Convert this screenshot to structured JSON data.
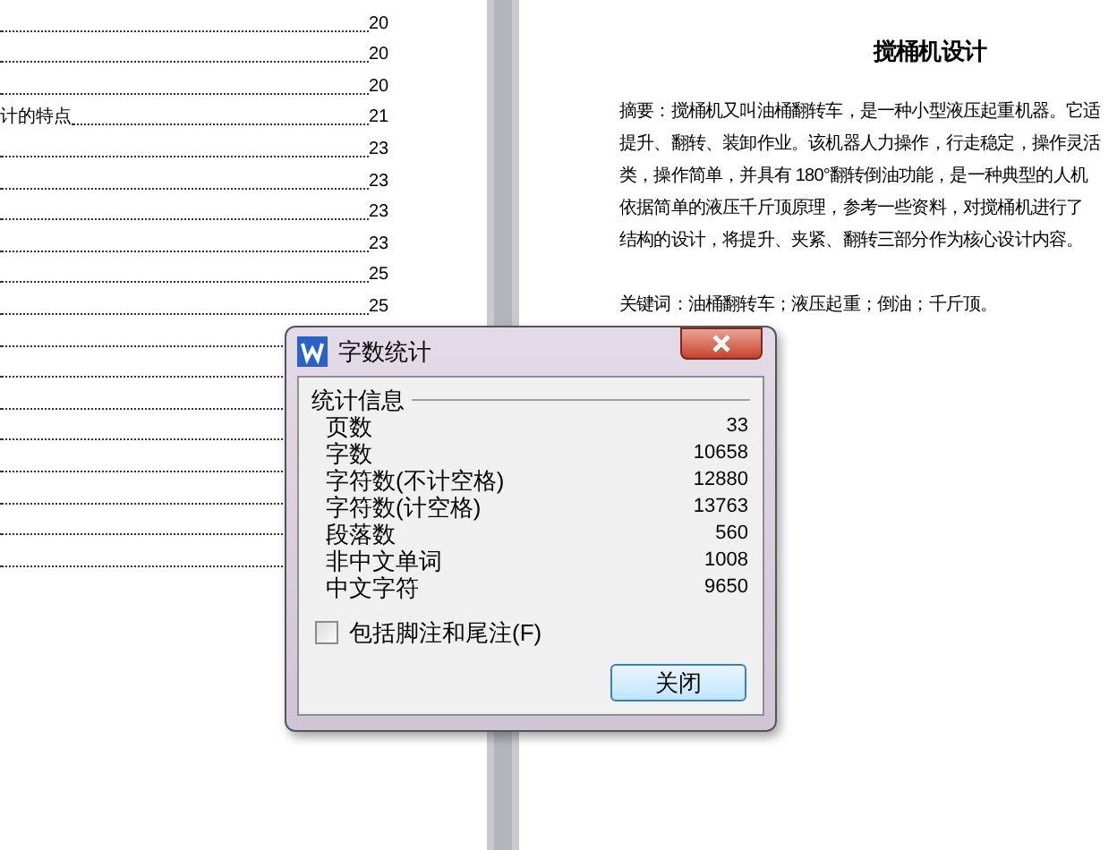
{
  "toc": [
    {
      "page": "20"
    },
    {
      "page": "20"
    },
    {
      "page": "20"
    },
    {
      "title": "计的特点",
      "page": "21"
    },
    {
      "page": "23"
    },
    {
      "page": "23"
    },
    {
      "page": "23"
    },
    {
      "page": "23"
    },
    {
      "page": "25"
    },
    {
      "page": "25"
    }
  ],
  "document": {
    "title": "搅桶机设计",
    "abstract_lines": [
      "摘要：搅桶机又叫油桶翻转车，是一种小型液压起重机器。它适",
      "提升、翻转、装卸作业。该机器人力操作，行走稳定，操作灵活",
      "类，操作简单，并具有 180°翻转倒油功能，是一种典型的人机",
      "依据简单的液压千斤顶原理，参考一些资料，对搅桶机进行了",
      "结构的设计，将提升、夹紧、翻转三部分作为核心设计内容。"
    ],
    "keywords": "关键词：油桶翻转车；液压起重；倒油；千斤顶。"
  },
  "dialog": {
    "title": "字数统计",
    "group": "统计信息",
    "stats": [
      {
        "label": "页数",
        "value": "33"
      },
      {
        "label": "字数",
        "value": "10658"
      },
      {
        "label": "字符数(不计空格)",
        "value": "12880"
      },
      {
        "label": "字符数(计空格)",
        "value": "13763"
      },
      {
        "label": "段落数",
        "value": "560"
      },
      {
        "label": "非中文单词",
        "value": "1008"
      },
      {
        "label": "中文字符",
        "value": "9650"
      }
    ],
    "checkbox": {
      "label": "包括脚注和尾注(F)",
      "checked": false
    },
    "button": "关闭"
  }
}
